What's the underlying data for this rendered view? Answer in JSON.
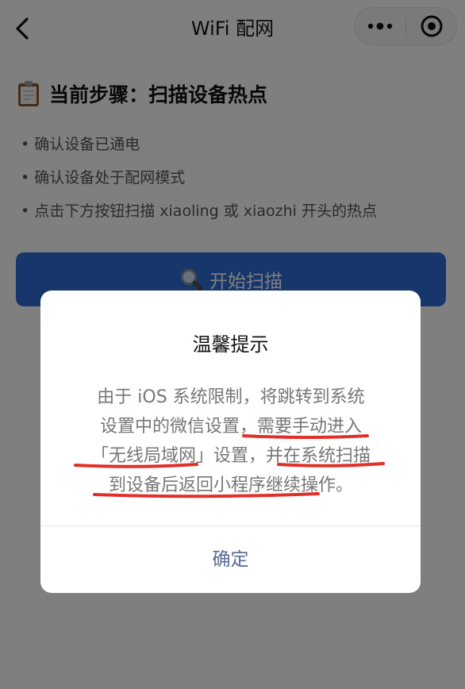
{
  "navbar": {
    "title": "WiFi 配网"
  },
  "step": {
    "title": "当前步骤：扫描设备热点",
    "icon": "clipboard-icon"
  },
  "tips": [
    "• 确认设备已通电",
    "• 确认设备处于配网模式",
    "• 点击下方按钮扫描 xiaoling 或 xiaozhi 开头的热点"
  ],
  "scan_button": {
    "label": "开始扫描",
    "icon": "magnifier-icon"
  },
  "dialog": {
    "title": "温馨提示",
    "lines": [
      "由于 iOS 系统限制，将跳转到系统",
      "设置中的微信设置，需要手动进入",
      "「无线局域网」设置，并在系统扫描",
      "到设备后返回小程序继续操作。"
    ],
    "confirm_label": "确定"
  },
  "colors": {
    "primary": "#2f6fd9",
    "confirm_text": "#576b95",
    "annotation_underline": "#e0302a"
  }
}
